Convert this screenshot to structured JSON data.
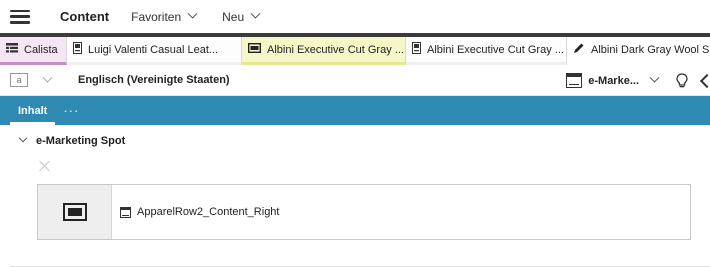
{
  "header": {
    "app_title": "Content",
    "menu": [
      {
        "label": "Favoriten"
      },
      {
        "label": "Neu"
      }
    ]
  },
  "tabs": [
    {
      "label": "Calista",
      "icon": "list-icon"
    },
    {
      "label": "Luigi Valenti Casual Leat...",
      "icon": "product-icon"
    },
    {
      "label": "Albini Executive Cut Gray ...",
      "icon": "display-icon"
    },
    {
      "label": "Albini Executive Cut Gray ...",
      "icon": "product-icon"
    },
    {
      "label": "Albini Dark Gray Wool Sui...",
      "icon": "pencil-icon"
    }
  ],
  "toolbar": {
    "language": "Englisch (Vereinigte Staaten)",
    "doc_label": "e-Marke...",
    "lang_icon_text": "a"
  },
  "form_tabs": {
    "active": "Inhalt",
    "more": "···"
  },
  "section": {
    "title": "e-Marketing Spot",
    "item_label": "ApparelRow2_Content_Right"
  },
  "colors": {
    "accent": "#2f8ab3",
    "tab_active_pink": "#f6e6f5",
    "tab_yellow": "#f6f7c8"
  }
}
